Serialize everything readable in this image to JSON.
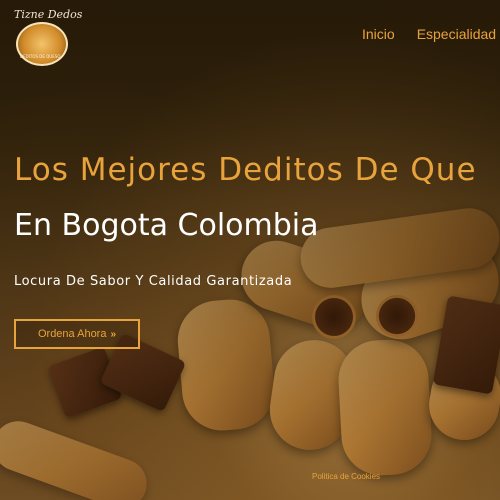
{
  "logo": {
    "name": "Tizne Dedos",
    "subtitle": "DEDITOS DE QUESO"
  },
  "nav": {
    "items": [
      "Inicio",
      "Especialidad"
    ]
  },
  "hero": {
    "title": "Los Mejores Deditos De Que",
    "subtitle": "En Bogota Colombia",
    "tagline": "Locura De Sabor Y Calidad Garantizada",
    "cta_label": "Ordena Ahora",
    "cta_icon": "»"
  },
  "footer": {
    "link": "Politica de Cookies"
  },
  "colors": {
    "accent": "#e9a33c",
    "text": "#ffffff",
    "background": "#3a2a10"
  }
}
